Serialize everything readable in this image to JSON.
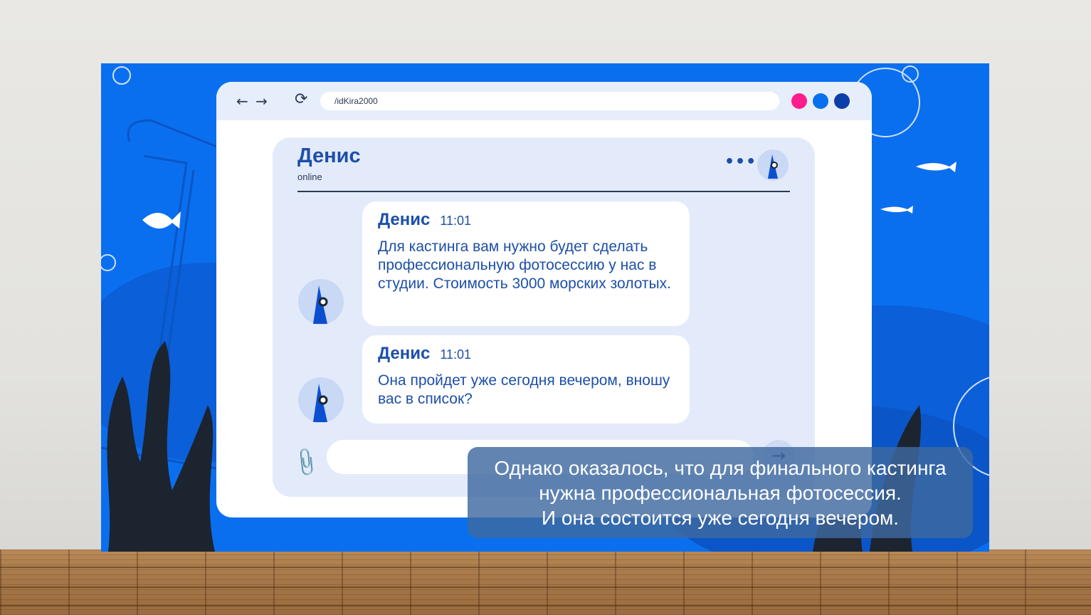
{
  "browser": {
    "url": "/idKira2000",
    "dots": [
      "#ff1d8e",
      "#0a6fef",
      "#0d3fa8"
    ]
  },
  "chat": {
    "contact_name": "Денис",
    "status": "online",
    "messages": [
      {
        "sender": "Денис",
        "time": "11:01",
        "text": "Для кастинга вам нужно будет сделать профессиональную фотосессию у нас в студии. Стоимость 3000 морских золотых."
      },
      {
        "sender": "Денис",
        "time": "11:01",
        "text": "Она пройдет уже сегодня вечером, вношу вас в список?"
      }
    ],
    "input_placeholder": ""
  },
  "caption": {
    "line1": "Однако оказалось, что для финального кастинга",
    "line2": "нужна профессиональная фотосессия.",
    "line3": "И она состоится уже сегодня вечером."
  }
}
